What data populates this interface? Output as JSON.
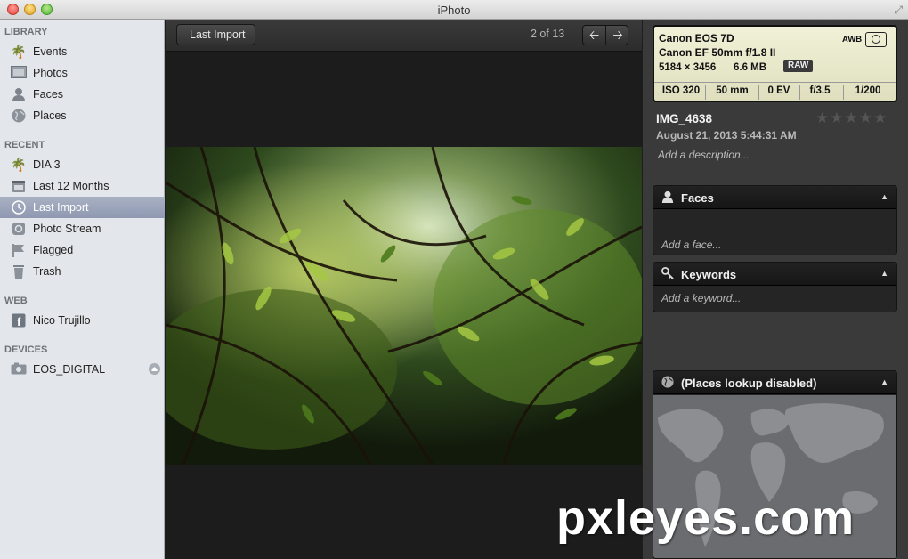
{
  "window": {
    "title": "iPhoto"
  },
  "colors": {
    "selection": "#8e98b0",
    "sidebar_bg": "#e3e6ea",
    "exif_bg": "#f1f1d8"
  },
  "sidebar": {
    "sections": [
      {
        "title": "LIBRARY"
      },
      {
        "title": "RECENT"
      },
      {
        "title": "WEB"
      },
      {
        "title": "DEVICES"
      }
    ],
    "items": [
      {
        "label": "Events",
        "icon": "palm-tree-icon"
      },
      {
        "label": "Photos",
        "icon": "photos-icon"
      },
      {
        "label": "Faces",
        "icon": "person-icon"
      },
      {
        "label": "Places",
        "icon": "globe-icon"
      },
      {
        "label": "DIA 3",
        "icon": "palm-tree-icon"
      },
      {
        "label": "Last 12 Months",
        "icon": "calendar-icon"
      },
      {
        "label": "Last Import",
        "icon": "clock-icon",
        "selected": true
      },
      {
        "label": "Photo Stream",
        "icon": "photo-stream-icon"
      },
      {
        "label": "Flagged",
        "icon": "flag-icon"
      },
      {
        "label": "Trash",
        "icon": "trash-icon"
      },
      {
        "label": "Nico Trujillo",
        "icon": "facebook-icon"
      },
      {
        "label": "EOS_DIGITAL",
        "icon": "camera-icon"
      }
    ]
  },
  "viewer": {
    "back_label": "Last Import",
    "counter": "2 of 13"
  },
  "info": {
    "exif": {
      "camera": "Canon EOS 7D",
      "lens": "Canon EF 50mm f/1.8 II",
      "dimensions": "5184 × 3456",
      "size": "6.6 MB",
      "format": "RAW",
      "white_balance": "AWB",
      "iso": "ISO 320",
      "focal": "50 mm",
      "ev": "0 EV",
      "aperture": "f/3.5",
      "shutter": "1/200"
    },
    "name": "IMG_4638",
    "date": "August 21, 2013 5:44:31 AM",
    "rating": 0,
    "description_placeholder": "Add a description...",
    "faces": {
      "title": "Faces",
      "placeholder": "Add a face..."
    },
    "keywords": {
      "title": "Keywords",
      "placeholder": "Add a keyword..."
    },
    "places": {
      "title": "(Places lookup disabled)"
    }
  },
  "watermark": "pxleyes.com"
}
